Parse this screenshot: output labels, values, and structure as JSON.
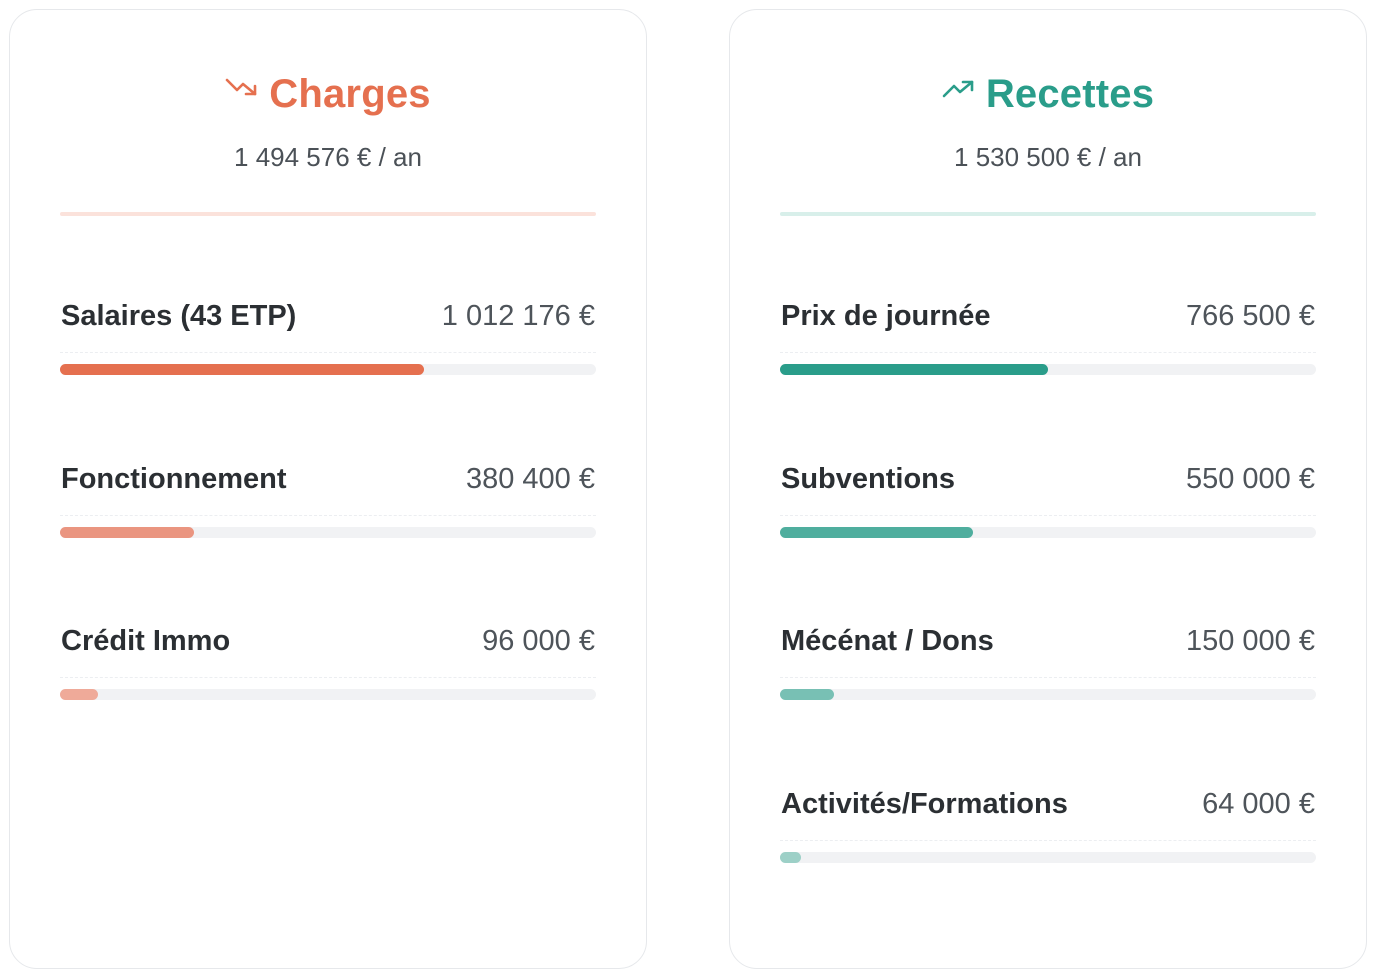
{
  "colors": {
    "charges_accent": "#e5704f",
    "recettes_accent": "#2a9d8a",
    "text_dark": "#2b2f33",
    "text_muted": "#4e545a",
    "track": "#f1f2f4"
  },
  "charges": {
    "icon": "trending-down-icon",
    "title": "Charges",
    "subtitle": "1 494 576 € / an",
    "items": [
      {
        "label": "Salaires (43 ETP)",
        "amount": "1 012 176 €",
        "share": 0.68,
        "color": "#e5704f"
      },
      {
        "label": "Fonctionnement",
        "amount": "380 400 €",
        "share": 0.25,
        "color": "#ea9580"
      },
      {
        "label": "Crédit Immo",
        "amount": "96 000 €",
        "share": 0.07,
        "color": "#efaa99"
      }
    ]
  },
  "recettes": {
    "icon": "trending-up-icon",
    "title": "Recettes",
    "subtitle": "1 530 500 € / an",
    "items": [
      {
        "label": "Prix de journée",
        "amount": "766 500 €",
        "share": 0.5,
        "color": "#2a9d8a"
      },
      {
        "label": "Subventions",
        "amount": "550 000 €",
        "share": 0.36,
        "color": "#4fae9e"
      },
      {
        "label": "Mécénat / Dons",
        "amount": "150 000 €",
        "share": 0.1,
        "color": "#78c0b4"
      },
      {
        "label": "Activités/Formations",
        "amount": "64 000 €",
        "share": 0.04,
        "color": "#9dd0c7"
      }
    ]
  }
}
